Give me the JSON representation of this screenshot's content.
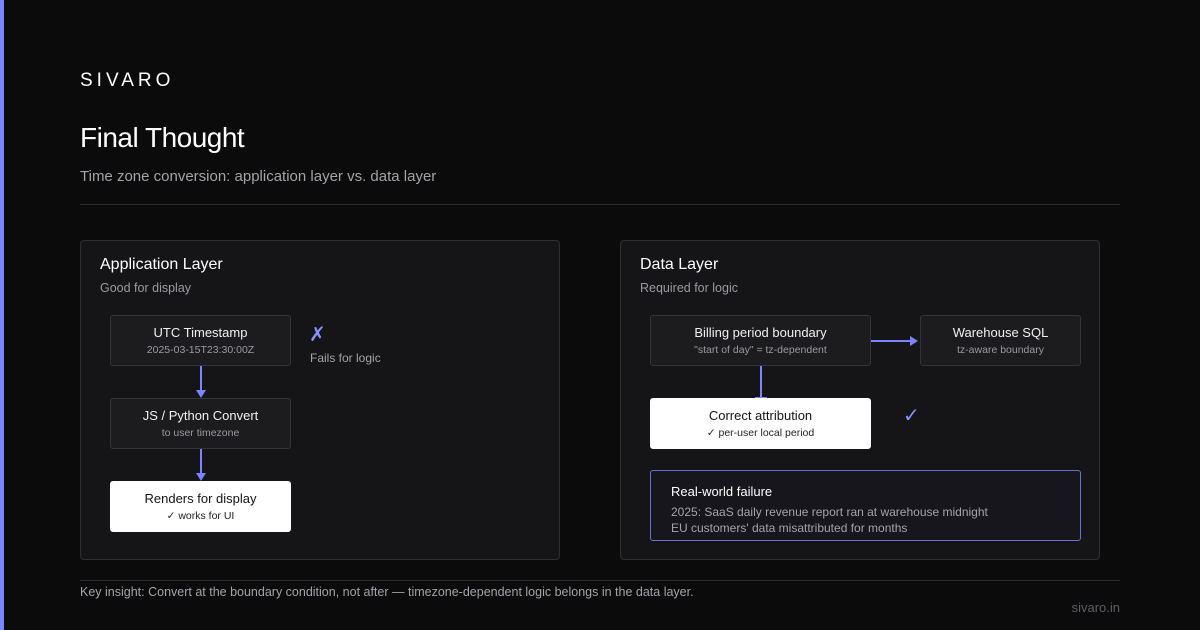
{
  "brand": "SIVARO",
  "title": "Final Thought",
  "subtitle": "Time zone conversion: application layer vs. data layer",
  "accent_color": "#7c83ff",
  "app_layer": {
    "title": "Application Layer",
    "subtitle": "Good for display",
    "nodes": [
      {
        "main": "UTC Timestamp",
        "sub": "2025-03-15T23:30:00Z"
      },
      {
        "main": "JS / Python Convert",
        "sub": "to user timezone"
      },
      {
        "main": "Renders for display",
        "sub": "✓ works for UI"
      }
    ],
    "fail_mark": "✗",
    "fail_note": "Fails for logic"
  },
  "data_layer": {
    "title": "Data Layer",
    "subtitle": "Required for logic",
    "nodes": [
      {
        "main": "Billing period boundary",
        "sub": "\"start of day\" = tz-dependent"
      },
      {
        "main": "Warehouse SQL",
        "sub": "tz-aware boundary"
      },
      {
        "main": "Correct attribution",
        "sub": "✓ per-user local period"
      }
    ],
    "ok_mark": "✓",
    "callout": {
      "title": "Real-world failure",
      "line1": "2025: SaaS daily revenue report ran at warehouse midnight",
      "line2": "EU customers' data misattributed for months"
    }
  },
  "footer": "Key insight: Convert at the boundary condition, not after — timezone-dependent logic belongs in the data layer.",
  "url": "sivaro.in"
}
